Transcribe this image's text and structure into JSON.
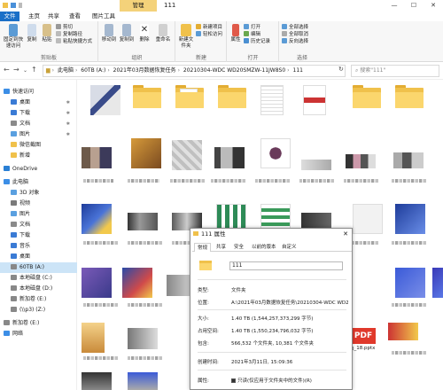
{
  "window": {
    "manage_tab": "管理",
    "title": "111",
    "min": "—",
    "max": "☐",
    "close": "✕"
  },
  "ribbon_tabs": [
    {
      "label": "文件"
    },
    {
      "label": "主页"
    },
    {
      "label": "共享"
    },
    {
      "label": "查看"
    },
    {
      "label": "图片工具"
    }
  ],
  "ribbon": {
    "groups": {
      "clipboard": "剪贴板",
      "organize": "组织",
      "new": "新建",
      "open": "打开",
      "select": "选择"
    },
    "pin": "固定到快速访问",
    "copy": "复制",
    "paste": "粘贴",
    "cut": "剪切",
    "copy_path": "复制路径",
    "paste_shortcut": "粘贴快捷方式",
    "move_to": "移动到",
    "copy_to": "复制到",
    "delete": "删除",
    "rename": "重命名",
    "new_folder": "新建文件夹",
    "new_item": "新建项目",
    "easy_access": "轻松访问",
    "properties": "属性",
    "open": "打开",
    "edit": "编辑",
    "history": "历史记录",
    "select_all": "全部选择",
    "select_none": "全部取消",
    "invert": "反向选择"
  },
  "address": {
    "crumbs": [
      "此电脑",
      "60TB (A:)",
      "2021年03月数据恢复任务",
      "20210304-WDC WD20SMZW-11JW8S0",
      "111"
    ],
    "search_placeholder": "搜索\"111\""
  },
  "nav": [
    {
      "label": "快速访问",
      "color": "#3c8ee6"
    },
    {
      "label": "桌面",
      "color": "#3a7bd5"
    },
    {
      "label": "下载",
      "color": "#3a7bd5"
    },
    {
      "label": "文档",
      "color": "#8a8a8a"
    },
    {
      "label": "图片",
      "color": "#5aa0e0"
    },
    {
      "label": "微信截图",
      "color": "#f0c14b"
    },
    {
      "label": "新增",
      "color": "#f0c14b"
    },
    {
      "label": "OneDrive",
      "color": "#2a7fd4"
    },
    {
      "label": "此电脑",
      "color": "#3c8ee6"
    },
    {
      "label": "3D 对象",
      "color": "#5aa0e0"
    },
    {
      "label": "视频",
      "color": "#7a7a7a"
    },
    {
      "label": "图片",
      "color": "#5aa0e0"
    },
    {
      "label": "文档",
      "color": "#8a8a8a"
    },
    {
      "label": "下载",
      "color": "#3a7bd5"
    },
    {
      "label": "音乐",
      "color": "#3a7bd5"
    },
    {
      "label": "桌面",
      "color": "#3a7bd5"
    },
    {
      "label": "60TB (A:)",
      "color": "#888"
    },
    {
      "label": "本地磁盘 (C:)",
      "color": "#888"
    },
    {
      "label": "本地磁盘 (D:)",
      "color": "#888"
    },
    {
      "label": "新加卷 (E:)",
      "color": "#888"
    },
    {
      "label": "(\\\\p3) (Z:)",
      "color": "#888"
    },
    {
      "label": "新加卷 (E:)",
      "color": "#888"
    },
    {
      "label": "网络",
      "color": "#3c8ee6"
    }
  ],
  "content": {
    "pdf_label": "PDF",
    "file_label": "ŋ_18.pptx"
  },
  "dialog": {
    "title": "111 属性",
    "close": "✕",
    "tabs": [
      "常规",
      "共享",
      "安全",
      "以前的版本",
      "自定义"
    ],
    "name": "111",
    "rows": [
      {
        "label": "类型:",
        "value": "文件夹"
      },
      {
        "label": "位置:",
        "value": "A:\\2021年03月数据恢复任务\\20210304-WDC WD20"
      },
      {
        "label": "大小:",
        "value": "1.40 TB (1,544,257,373,299 字节)"
      },
      {
        "label": "占用空间:",
        "value": "1.40 TB (1,550,234,796,032 字节)"
      },
      {
        "label": "包含:",
        "value": "566,532 个文件夹, 10,381 个文件夹"
      },
      {
        "label": "创建时间:",
        "value": "2021年3月11日, 15:09:36"
      },
      {
        "label": "属性:",
        "value": "只读(仅应用于文件夹中的文件)(R)"
      }
    ]
  }
}
